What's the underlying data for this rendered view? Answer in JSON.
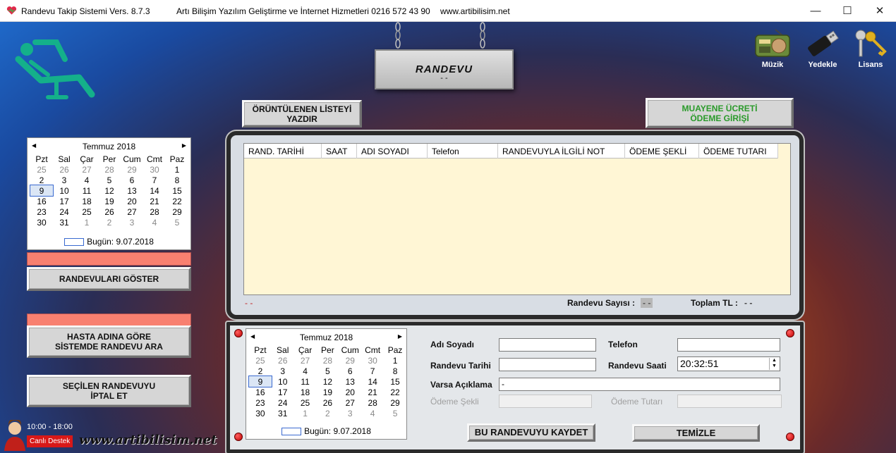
{
  "titlebar": {
    "title": "Randevu Takip Sistemi  Vers. 8.7.3",
    "company": "Artı Bilişim Yazılım Geliştirme ve İnternet Hizmetleri  0216 572 43 90",
    "website": "www.artibilisim.net"
  },
  "sign": {
    "title": "RANDEVU",
    "subtitle": "- -"
  },
  "top_icons": {
    "music": "Müzik",
    "backup": "Yedekle",
    "license": "Lisans"
  },
  "buttons": {
    "print_list": "ÖRÜNTÜLENEN LİSTEYİ\nYAZDIR",
    "fee_entry": "MUAYENE ÜCRETİ\nÖDEME GİRİŞİ",
    "show_appointments": "RANDEVULARI GÖSTER",
    "search_by_patient": "HASTA ADINA GÖRE\nSİSTEMDE RANDEVU ARA",
    "cancel_selected": "SEÇİLEN RANDEVUYU\nİPTAL ET",
    "save": "BU RANDEVUYU KAYDET",
    "clear": "TEMİZLE"
  },
  "calendar": {
    "month": "Temmuz 2018",
    "days": [
      "Pzt",
      "Sal",
      "Çar",
      "Per",
      "Cum",
      "Cmt",
      "Paz"
    ],
    "weeks": [
      [
        "25",
        "26",
        "27",
        "28",
        "29",
        "30",
        "1"
      ],
      [
        "2",
        "3",
        "4",
        "5",
        "6",
        "7",
        "8"
      ],
      [
        "9",
        "10",
        "11",
        "12",
        "13",
        "14",
        "15"
      ],
      [
        "16",
        "17",
        "18",
        "19",
        "20",
        "21",
        "22"
      ],
      [
        "23",
        "24",
        "25",
        "26",
        "27",
        "28",
        "29"
      ],
      [
        "30",
        "31",
        "1",
        "2",
        "3",
        "4",
        "5"
      ]
    ],
    "today": "Bugün: 9.07.2018",
    "selected": "9"
  },
  "grid": {
    "columns": [
      "RAND. TARİHİ",
      "SAAT",
      "ADI SOYADI",
      "Telefon",
      "RANDEVUYLA İLGİLİ NOT",
      "ÖDEME ŞEKLİ",
      "ÖDEME TUTARI"
    ]
  },
  "footer": {
    "left_status": "- -",
    "count_label": "Randevu Sayısı :",
    "count_value": "- -",
    "total_label": "Toplam TL :",
    "total_value": "- -"
  },
  "form": {
    "name_label": "Adı Soyadı",
    "name_value": "",
    "phone_label": "Telefon",
    "phone_value": "",
    "date_label": "Randevu Tarihi",
    "date_value": "",
    "time_label": "Randevu Saati",
    "time_value": "20:32:51",
    "note_label": "Varsa Açıklama",
    "note_value": "-",
    "payment_type_label": "Ödeme Şekli",
    "payment_amount_label": "Ödeme Tutarı"
  },
  "live_support": {
    "hours": "10:00 - 18:00",
    "label": "Canlı Destek"
  },
  "site_banner": "www.artibilisim.net"
}
